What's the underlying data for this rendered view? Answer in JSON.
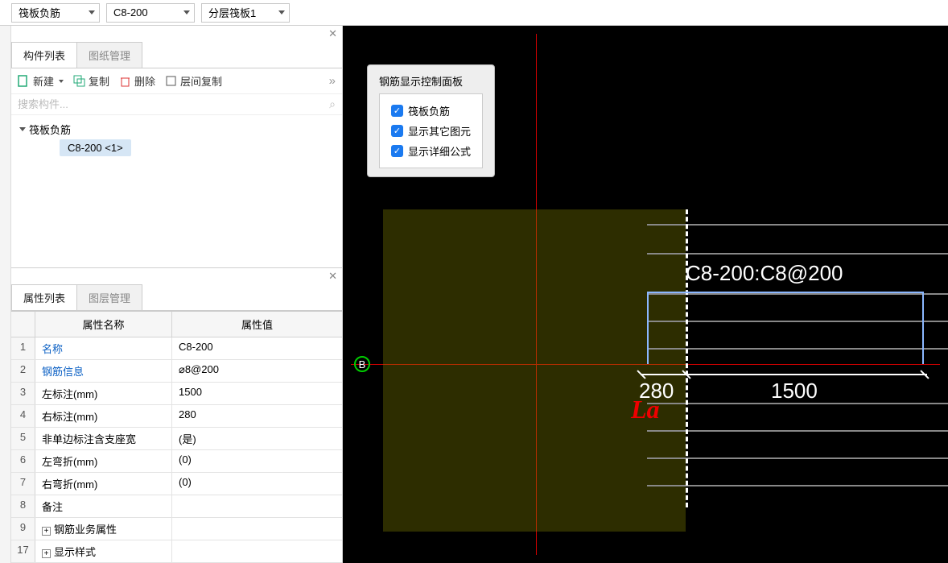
{
  "top": {
    "dd1": "筏板负筋",
    "dd2": "C8-200",
    "dd3": "分层筏板1"
  },
  "left": {
    "tab_component_list": "构件列表",
    "tab_drawing_manage": "图纸管理",
    "toolbar": {
      "new": "新建",
      "copy": "复制",
      "delete": "删除",
      "floor_copy": "层间复制"
    },
    "search_placeholder": "搜索构件...",
    "tree": {
      "root": "筏板负筋",
      "child": "C8-200  <1>"
    }
  },
  "props": {
    "tab_attr_list": "属性列表",
    "tab_layer_manage": "图层管理",
    "head_name": "属性名称",
    "head_value": "属性值",
    "rows": [
      {
        "idx": "1",
        "name": "名称",
        "value": "C8-200",
        "blue": true
      },
      {
        "idx": "2",
        "name": "钢筋信息",
        "value": "⌀8@200",
        "blue": true
      },
      {
        "idx": "3",
        "name": "左标注(mm)",
        "value": "1500"
      },
      {
        "idx": "4",
        "name": "右标注(mm)",
        "value": "280"
      },
      {
        "idx": "5",
        "name": "非单边标注含支座宽",
        "value": "(是)"
      },
      {
        "idx": "6",
        "name": "左弯折(mm)",
        "value": "(0)"
      },
      {
        "idx": "7",
        "name": "右弯折(mm)",
        "value": "(0)"
      },
      {
        "idx": "8",
        "name": "备注",
        "value": ""
      },
      {
        "idx": "9",
        "name": "钢筋业务属性",
        "value": "",
        "expand": true
      },
      {
        "idx": "17",
        "name": "显示样式",
        "value": "",
        "expand": true
      }
    ]
  },
  "canvas": {
    "panel_title": "钢筋显示控制面板",
    "checks": [
      "筏板负筋",
      "显示其它图元",
      "显示详细公式"
    ],
    "rebar_label": "C8-200:C8@200",
    "dim_left": "280",
    "dim_right": "1500",
    "annotation": "La",
    "point": "B"
  }
}
